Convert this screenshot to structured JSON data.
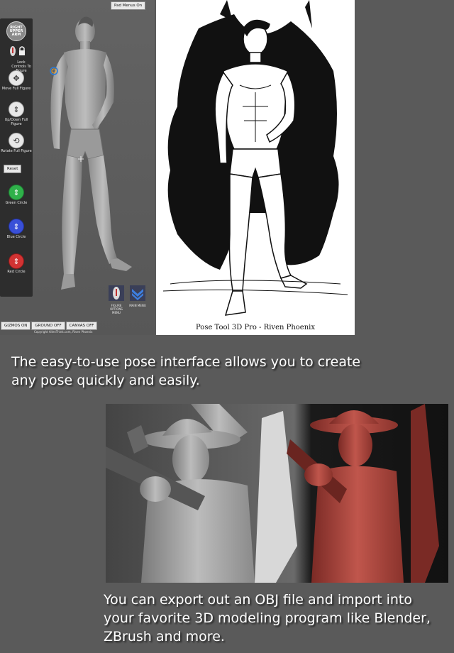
{
  "app": {
    "pad_menus": "Pad Menus On",
    "tools": [
      {
        "name": "badge",
        "label": "RIGHT UPPER ARM"
      },
      {
        "name": "lock",
        "label": "Lock Controls To Figure"
      },
      {
        "name": "move",
        "label": "Move Full Figure"
      },
      {
        "name": "updown",
        "label": "Up/Down Full Figure"
      },
      {
        "name": "rotate",
        "label": "Rotate Full Figure"
      },
      {
        "name": "green",
        "label": "Green Circle"
      },
      {
        "name": "blue",
        "label": "Blue Circle"
      },
      {
        "name": "red",
        "label": "Red Circle"
      }
    ],
    "reset": "Reset",
    "menus": {
      "figure_options": "FIGURE OPTIONS MENU",
      "main_menu": "MAIN MENU"
    },
    "bottom_buttons": [
      "GIZMOS ON",
      "GROUND OFF",
      "CANVAS OFF"
    ],
    "copyright": "Copyright AlienThink.com, Riven Phoenix"
  },
  "sketch": {
    "caption": "Pose Tool 3D Pro - Riven Phoenix"
  },
  "texts": {
    "intro": "The easy-to-use pose interface allows you to create any pose quickly and easily.",
    "export": "You can export out an OBJ file and import into your favorite 3D modeling program like Blender, ZBrush and more."
  },
  "colors": {
    "background": "#5a5a5a",
    "toolbar": "#2d2d2d",
    "green": "#2fb14a",
    "blue": "#3950d8",
    "red": "#d23333",
    "render_red": "#a7453e"
  }
}
